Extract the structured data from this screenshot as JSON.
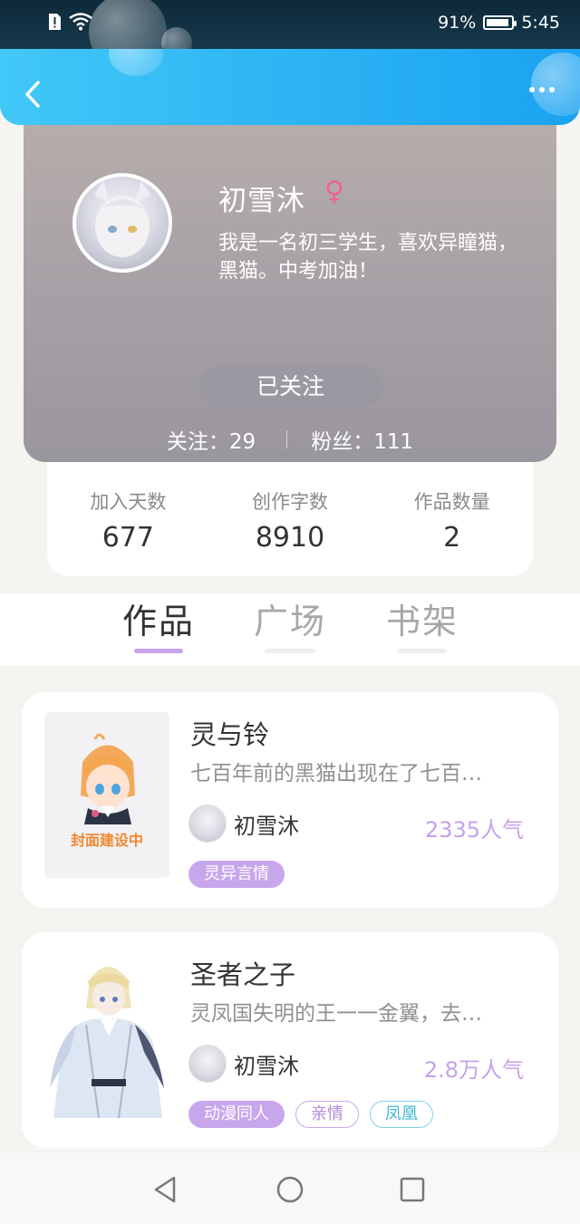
{
  "status_bar": {
    "battery_text": "91%",
    "battery_level": 0.91,
    "time": "5:45",
    "icons": [
      "sim-alert-icon",
      "wifi-icon",
      "battery-icon"
    ]
  },
  "header": {
    "back_icon": "chevron-left-icon",
    "more_icon": "more-dots-icon"
  },
  "profile": {
    "name": "初雪沐",
    "gender_symbol": "♀",
    "bio": "我是一名初三学生，喜欢异瞳猫，黑猫。中考加油！",
    "follow_button": "已关注",
    "following": "关注：29",
    "followers": "粉丝：111"
  },
  "stats": [
    {
      "label": "加入天数",
      "value": "677"
    },
    {
      "label": "创作字数",
      "value": "8910"
    },
    {
      "label": "作品数量",
      "value": "2"
    }
  ],
  "tabs": [
    {
      "label": "作品",
      "active": true
    },
    {
      "label": "广场",
      "active": false
    },
    {
      "label": "书架",
      "active": false
    }
  ],
  "works": [
    {
      "title": "灵与铃",
      "description": "七百年前的黑猫出现在了七百…",
      "author": "初雪沐",
      "popularity": "2335人气",
      "cover_caption": "封面建设中",
      "tags": [
        {
          "label": "灵异言情",
          "style": "filled"
        }
      ]
    },
    {
      "title": "圣者之子",
      "description": "灵凤国失明的王一一金翼，去…",
      "author": "初雪沐",
      "popularity": "2.8万人气",
      "tags": [
        {
          "label": "动漫同人",
          "style": "filled"
        },
        {
          "label": "亲情",
          "style": "purple"
        },
        {
          "label": "凤凰",
          "style": "cyan"
        }
      ]
    }
  ],
  "colors": {
    "header_start": "#41c8f7",
    "header_end": "#1aa2f1",
    "accent_purple": "#c7a5ea",
    "popularity": "#c6a3e8",
    "gender": "#f06292"
  }
}
